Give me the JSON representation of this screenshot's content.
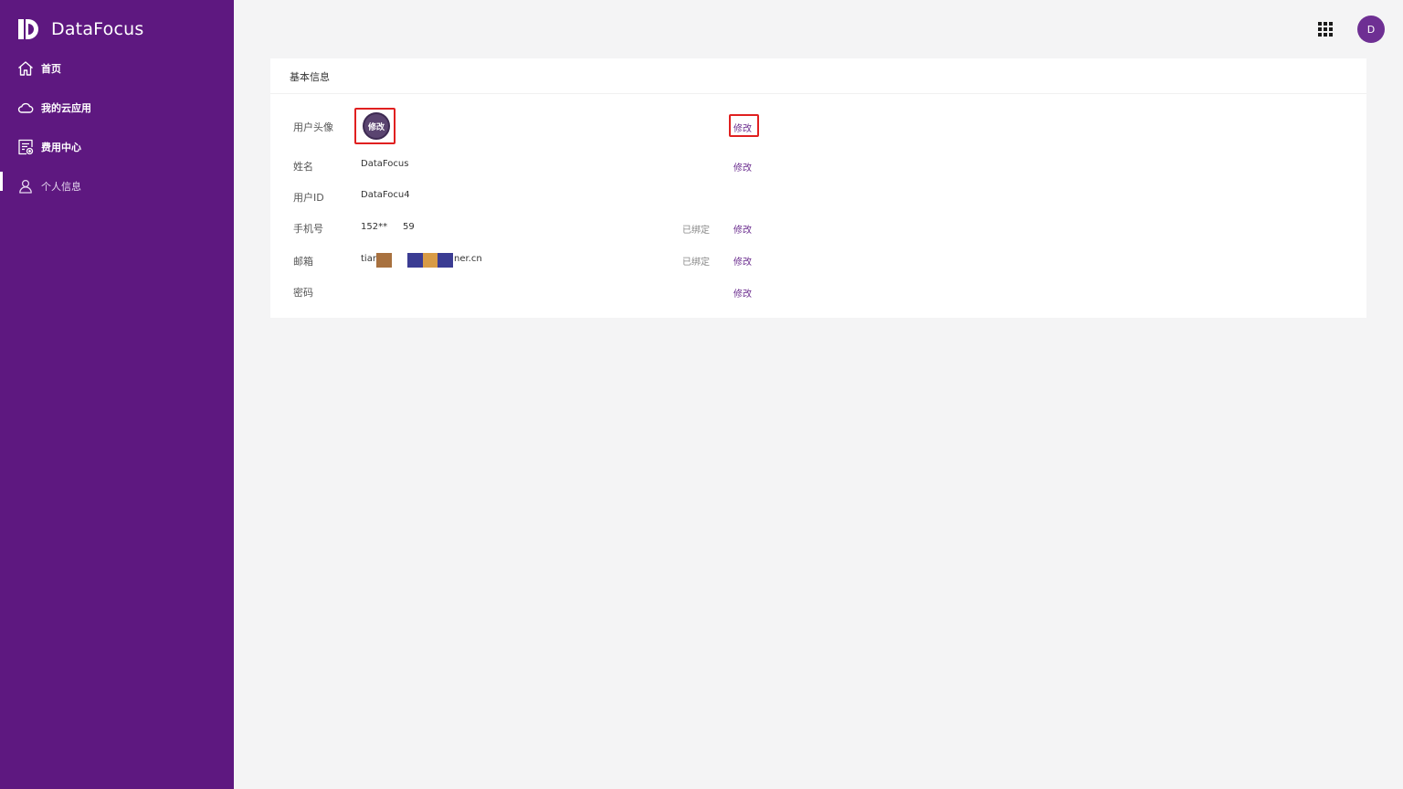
{
  "brand": {
    "name": "DataFocus"
  },
  "sidebar": {
    "items": [
      {
        "label": "首页",
        "icon": "home-icon"
      },
      {
        "label": "我的云应用",
        "icon": "cloud-icon"
      },
      {
        "label": "费用中心",
        "icon": "billing-icon"
      },
      {
        "label": "个人信息",
        "icon": "user-icon",
        "active": true
      }
    ]
  },
  "header": {
    "apps_icon": "grid-apps-icon",
    "avatar_letter": "D"
  },
  "card": {
    "title": "基本信息",
    "rows": {
      "avatar": {
        "label": "用户头像",
        "avatar_text": "修改",
        "action": "修改"
      },
      "name": {
        "label": "姓名",
        "value": "DataFocus",
        "action": "修改"
      },
      "userid": {
        "label": "用户ID",
        "value": "DataFocu4"
      },
      "phone": {
        "label": "手机号",
        "value_start": "152**",
        "value_end": "59",
        "status": "已绑定",
        "action": "修改"
      },
      "email": {
        "label": "邮箱",
        "value_start": "tian",
        "value_end": "ner.cn",
        "status": "已绑定",
        "action": "修改"
      },
      "password": {
        "label": "密码",
        "action": "修改"
      }
    }
  },
  "colors": {
    "sidebar": "#5e1880",
    "accent": "#6b2d8f",
    "highlight": "#e02020",
    "background": "#f4f4f5"
  }
}
